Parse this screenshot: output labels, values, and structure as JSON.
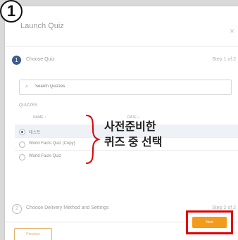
{
  "badge": "1",
  "modal": {
    "title": "Launch Quiz",
    "close_icon": "close-icon",
    "step1": {
      "number": "1",
      "label": "Choose Quiz",
      "counter": "Step 1 of 2"
    },
    "search": {
      "placeholder": "Search Quizzes",
      "icon": "search-icon"
    },
    "quizzes": {
      "section_label": "QUIZZES",
      "columns": [
        "NAME ↑",
        "DATE ↓"
      ],
      "rows": [
        {
          "name": "테스트",
          "selected": true
        },
        {
          "name": "World Facts Quiz (Copy)",
          "selected": false
        },
        {
          "name": "World Facts Quiz",
          "selected": false
        }
      ]
    },
    "step2": {
      "number": "2",
      "label": "Choose Delivery Method and Settings",
      "counter": "Step 2 of 2"
    },
    "footer": {
      "previous_label": "Previous",
      "next_label": "Next"
    }
  },
  "annotation": {
    "text": "사전준비한\n퀴즈 중 선택"
  },
  "colors": {
    "accent": "#f39b1b",
    "step_circle": "#3d5d88",
    "highlight_box": "#e00000"
  }
}
